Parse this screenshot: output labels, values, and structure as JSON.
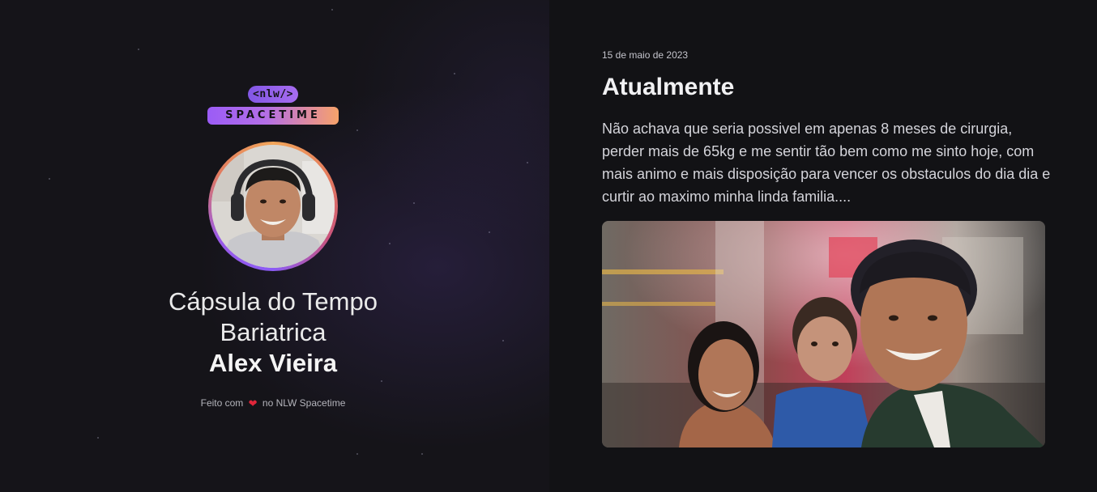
{
  "sidebar": {
    "logo": {
      "tag": "<nlw/>",
      "wordmark": "SPACETIME"
    },
    "avatar_name": "avatar",
    "title_line1": "Cápsula do Tempo",
    "title_line2": "Bariatrica",
    "author": "Alex Vieira",
    "footer_prefix": "Feito com",
    "footer_suffix": "no NLW Spacetime"
  },
  "memory": {
    "date": "15 de maio de 2023",
    "title": "Atualmente",
    "text": "Não achava que seria possivel em apenas 8 meses de cirurgia, perder mais de 65kg e me sentir tão bem como me sinto hoje, com mais animo e mais disposição para vencer os obstaculos do dia dia e curtir ao maximo minha linda familia...."
  },
  "colors": {
    "background": "#121215",
    "accent_purple": "#8257e5",
    "accent_orange": "#f6a36a",
    "heart": "#e0263a"
  }
}
